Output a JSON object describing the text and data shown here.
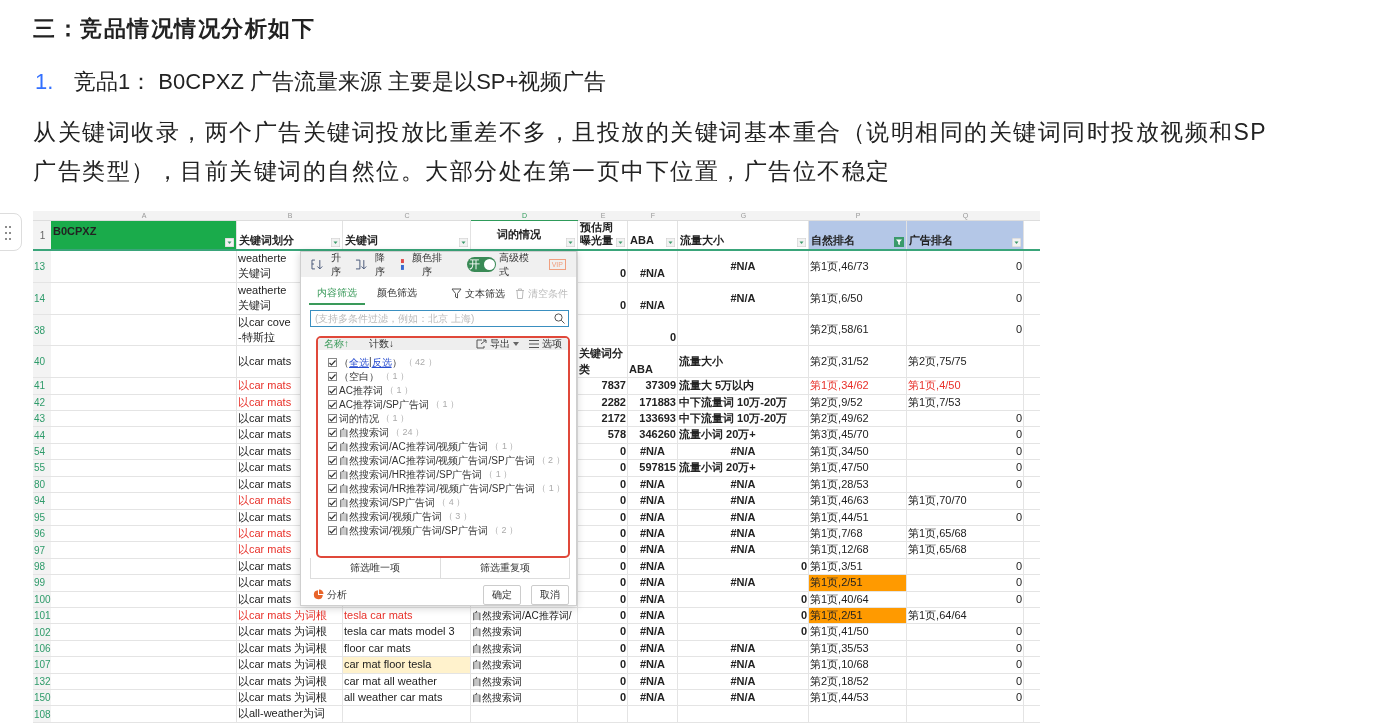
{
  "article": {
    "heading": "三：竞品情况情况分析如下",
    "list": [
      {
        "marker": "1.",
        "text": "竞品1： B0CPXZ 广告流量来源 主要是以SP+视频广告"
      }
    ],
    "paragraph": "从关键词收录，两个广告关键词投放比重差不多，且投放的关键词基本重合（说明相同的关键词同时投放视频和SP广告类型），目前关键词的自然位。大部分处在第一页中下位置，广告位不稳定"
  },
  "sheet": {
    "header_row_number": "1",
    "columns": [
      {
        "letter": "A",
        "header": "B0CPXZ",
        "color": "#1aab4b",
        "filter_active": false
      },
      {
        "letter": "B",
        "header": "关键词划分",
        "color": "#ffffff",
        "filter_active": false
      },
      {
        "letter": "C",
        "header": "关键词",
        "color": "#ffffff",
        "filter_active": false
      },
      {
        "letter": "D",
        "header": "词的情况",
        "color": "#ffffff",
        "filter_active": false
      },
      {
        "letter": "E",
        "header": "预估周曝光量",
        "color": "#ffffff",
        "filter_active": false
      },
      {
        "letter": "F",
        "header": "ABA",
        "color": "#ffffff",
        "filter_active": false
      },
      {
        "letter": "G",
        "header": "流量大小",
        "color": "#ffffff",
        "filter_active": false
      },
      {
        "letter": "P",
        "header": "自然排名",
        "color": "#b4c7e7",
        "filter_active": true
      },
      {
        "letter": "Q",
        "header": "广告排名",
        "color": "#b4c7e7",
        "filter_active": false
      }
    ],
    "rows": [
      {
        "number": "13",
        "cells": {
          "B": {
            "text": "weatherte\n关键词",
            "kind": "text"
          },
          "E": {
            "text": "0",
            "kind": "number"
          },
          "F": {
            "text": "#N/A",
            "kind": "error"
          },
          "G": {
            "text": "#N/A",
            "kind": "error"
          },
          "P": {
            "text": "第1页,46/73",
            "kind": "text"
          },
          "Q": {
            "text": "0",
            "kind": "number"
          }
        }
      },
      {
        "number": "14",
        "cells": {
          "B": {
            "text": "weatherte\n关键词",
            "kind": "text"
          },
          "E": {
            "text": "0",
            "kind": "number"
          },
          "F": {
            "text": "#N/A",
            "kind": "error"
          },
          "G": {
            "text": "#N/A",
            "kind": "error"
          },
          "P": {
            "text": "第1页,6/50",
            "kind": "text"
          },
          "Q": {
            "text": "0",
            "kind": "number"
          }
        }
      },
      {
        "number": "38",
        "cells": {
          "B": {
            "text": "以car cove\n-特斯拉",
            "kind": "text"
          },
          "F": {
            "text": "0",
            "kind": "number"
          },
          "P": {
            "text": "第2页,58/61",
            "kind": "text"
          },
          "Q": {
            "text": "0",
            "kind": "number"
          }
        }
      },
      {
        "number": "40",
        "cells": {
          "B": {
            "text": "以car mats",
            "kind": "text"
          },
          "E": {
            "text": "关键词分类",
            "kind": "text"
          },
          "F": {
            "text": "ABA",
            "kind": "text"
          },
          "G": {
            "text": "流量大小",
            "kind": "text"
          },
          "P": {
            "text": "第2页,31/52",
            "kind": "text"
          },
          "Q": {
            "text": "第2页,75/75",
            "kind": "text"
          }
        }
      },
      {
        "number": "41",
        "cells": {
          "B": {
            "text": "以car mats",
            "kind": "text",
            "color": "#e8312a"
          },
          "E": {
            "text": "7837",
            "kind": "number"
          },
          "F": {
            "text": "37309",
            "kind": "number"
          },
          "G": {
            "text": "流量大 5万以内",
            "kind": "text"
          },
          "P": {
            "text": "第1页,34/62",
            "kind": "text",
            "color": "#e8312a"
          },
          "Q": {
            "text": "第1页,4/50",
            "kind": "text",
            "color": "#e8312a"
          }
        }
      },
      {
        "number": "42",
        "cells": {
          "B": {
            "text": "以car mats",
            "kind": "text",
            "color": "#e8312a"
          },
          "E": {
            "text": "2282",
            "kind": "number"
          },
          "F": {
            "text": "171883",
            "kind": "number"
          },
          "G": {
            "text": "中下流量词 10万-20万",
            "kind": "text"
          },
          "P": {
            "text": "第2页,9/52",
            "kind": "text"
          },
          "Q": {
            "text": "第1页,7/53",
            "kind": "text"
          }
        }
      },
      {
        "number": "43",
        "cells": {
          "B": {
            "text": "以car mats",
            "kind": "text"
          },
          "E": {
            "text": "2172",
            "kind": "number"
          },
          "F": {
            "text": "133693",
            "kind": "number"
          },
          "G": {
            "text": "中下流量词 10万-20万",
            "kind": "text"
          },
          "P": {
            "text": "第2页,49/62",
            "kind": "text"
          },
          "Q": {
            "text": "0",
            "kind": "number"
          }
        }
      },
      {
        "number": "44",
        "cells": {
          "B": {
            "text": "以car mats",
            "kind": "text"
          },
          "E": {
            "text": "578",
            "kind": "number"
          },
          "F": {
            "text": "346260",
            "kind": "number"
          },
          "G": {
            "text": "流量小词 20万+",
            "kind": "text"
          },
          "P": {
            "text": "第3页,45/70",
            "kind": "text"
          },
          "Q": {
            "text": "0",
            "kind": "number"
          }
        }
      },
      {
        "number": "54",
        "cells": {
          "B": {
            "text": "以car mats",
            "kind": "text"
          },
          "E": {
            "text": "0",
            "kind": "number"
          },
          "F": {
            "text": "#N/A",
            "kind": "error"
          },
          "G": {
            "text": "#N/A",
            "kind": "error"
          },
          "P": {
            "text": "第1页,34/50",
            "kind": "text"
          },
          "Q": {
            "text": "0",
            "kind": "number"
          }
        }
      },
      {
        "number": "55",
        "cells": {
          "B": {
            "text": "以car mats",
            "kind": "text"
          },
          "E": {
            "text": "0",
            "kind": "number"
          },
          "F": {
            "text": "597815",
            "kind": "number"
          },
          "G": {
            "text": "流量小词 20万+",
            "kind": "text"
          },
          "P": {
            "text": "第1页,47/50",
            "kind": "text"
          },
          "Q": {
            "text": "0",
            "kind": "number"
          }
        }
      },
      {
        "number": "80",
        "cells": {
          "B": {
            "text": "以car mats",
            "kind": "text"
          },
          "E": {
            "text": "0",
            "kind": "number"
          },
          "F": {
            "text": "#N/A",
            "kind": "error"
          },
          "G": {
            "text": "#N/A",
            "kind": "error"
          },
          "P": {
            "text": "第1页,28/53",
            "kind": "text"
          },
          "Q": {
            "text": "0",
            "kind": "number"
          }
        }
      },
      {
        "number": "94",
        "cells": {
          "B": {
            "text": "以car mats",
            "kind": "text",
            "color": "#e8312a"
          },
          "E": {
            "text": "0",
            "kind": "number"
          },
          "F": {
            "text": "#N/A",
            "kind": "error"
          },
          "G": {
            "text": "#N/A",
            "kind": "error"
          },
          "P": {
            "text": "第1页,46/63",
            "kind": "text"
          },
          "Q": {
            "text": "第1页,70/70",
            "kind": "text"
          }
        }
      },
      {
        "number": "95",
        "cells": {
          "B": {
            "text": "以car mats",
            "kind": "text"
          },
          "E": {
            "text": "0",
            "kind": "number"
          },
          "F": {
            "text": "#N/A",
            "kind": "error"
          },
          "G": {
            "text": "#N/A",
            "kind": "error"
          },
          "P": {
            "text": "第1页,44/51",
            "kind": "text"
          },
          "Q": {
            "text": "0",
            "kind": "number"
          }
        }
      },
      {
        "number": "96",
        "cells": {
          "B": {
            "text": "以car mats",
            "kind": "text",
            "color": "#e8312a"
          },
          "E": {
            "text": "0",
            "kind": "number"
          },
          "F": {
            "text": "#N/A",
            "kind": "error"
          },
          "G": {
            "text": "#N/A",
            "kind": "error"
          },
          "P": {
            "text": "第1页,7/68",
            "kind": "text"
          },
          "Q": {
            "text": "第1页,65/68",
            "kind": "text"
          }
        }
      },
      {
        "number": "97",
        "cells": {
          "B": {
            "text": "以car mats",
            "kind": "text",
            "color": "#e8312a"
          },
          "E": {
            "text": "0",
            "kind": "number"
          },
          "F": {
            "text": "#N/A",
            "kind": "error"
          },
          "G": {
            "text": "#N/A",
            "kind": "error"
          },
          "P": {
            "text": "第1页,12/68",
            "kind": "text"
          },
          "Q": {
            "text": "第1页,65/68",
            "kind": "text"
          }
        }
      },
      {
        "number": "98",
        "cells": {
          "B": {
            "text": "以car mats",
            "kind": "text"
          },
          "E": {
            "text": "0",
            "kind": "number"
          },
          "F": {
            "text": "#N/A",
            "kind": "error"
          },
          "G": {
            "text": "0",
            "kind": "number"
          },
          "P": {
            "text": "第1页,3/51",
            "kind": "text"
          },
          "Q": {
            "text": "0",
            "kind": "number"
          }
        }
      },
      {
        "number": "99",
        "cells": {
          "B": {
            "text": "以car mats",
            "kind": "text"
          },
          "E": {
            "text": "0",
            "kind": "number"
          },
          "F": {
            "text": "#N/A",
            "kind": "error"
          },
          "G": {
            "text": "#N/A",
            "kind": "error"
          },
          "P": {
            "text": "第1页,2/51",
            "kind": "text",
            "background": {
              "color": "#ff9a00"
            }
          },
          "Q": {
            "text": "0",
            "kind": "number"
          }
        }
      },
      {
        "number": "100",
        "cells": {
          "B": {
            "text": "以car mats",
            "kind": "text"
          },
          "E": {
            "text": "0",
            "kind": "number"
          },
          "F": {
            "text": "#N/A",
            "kind": "error"
          },
          "G": {
            "text": "0",
            "kind": "number"
          },
          "P": {
            "text": "第1页,40/64",
            "kind": "text"
          },
          "Q": {
            "text": "0",
            "kind": "number"
          }
        }
      },
      {
        "number": "101",
        "cells": {
          "B": {
            "text": "以car mats 为词根",
            "kind": "text",
            "color": "#e8312a"
          },
          "C": {
            "text": "tesla car mats",
            "kind": "text",
            "color": "#e8312a"
          },
          "D": {
            "text": "自然搜索词/AC推荐词/",
            "kind": "text"
          },
          "E": {
            "text": "0",
            "kind": "number"
          },
          "F": {
            "text": "#N/A",
            "kind": "error"
          },
          "G": {
            "text": "0",
            "kind": "number"
          },
          "P": {
            "text": "第1页,2/51",
            "kind": "text",
            "background": {
              "color": "#ff9a00"
            }
          },
          "Q": {
            "text": "第1页,64/64",
            "kind": "text"
          }
        }
      },
      {
        "number": "102",
        "cells": {
          "B": {
            "text": "以car mats 为词根",
            "kind": "text"
          },
          "C": {
            "text": "tesla car mats model 3",
            "kind": "text"
          },
          "D": {
            "text": "自然搜索词",
            "kind": "text"
          },
          "E": {
            "text": "0",
            "kind": "number"
          },
          "F": {
            "text": "#N/A",
            "kind": "error"
          },
          "G": {
            "text": "0",
            "kind": "number"
          },
          "P": {
            "text": "第1页,41/50",
            "kind": "text"
          },
          "Q": {
            "text": "0",
            "kind": "number"
          }
        }
      },
      {
        "number": "106",
        "cells": {
          "B": {
            "text": "以car mats 为词根",
            "kind": "text"
          },
          "C": {
            "text": "floor car mats",
            "kind": "text"
          },
          "D": {
            "text": "自然搜索词",
            "kind": "text"
          },
          "E": {
            "text": "0",
            "kind": "number"
          },
          "F": {
            "text": "#N/A",
            "kind": "error"
          },
          "G": {
            "text": "#N/A",
            "kind": "error"
          },
          "P": {
            "text": "第1页,35/53",
            "kind": "text"
          },
          "Q": {
            "text": "0",
            "kind": "number"
          }
        }
      },
      {
        "number": "107",
        "cells": {
          "B": {
            "text": "以car mats 为词根",
            "kind": "text"
          },
          "C": {
            "text": "car mat floor tesla",
            "kind": "text",
            "background": {
              "color": "#fff2cc"
            }
          },
          "D": {
            "text": "自然搜索词",
            "kind": "text"
          },
          "E": {
            "text": "0",
            "kind": "number"
          },
          "F": {
            "text": "#N/A",
            "kind": "error"
          },
          "G": {
            "text": "#N/A",
            "kind": "error"
          },
          "P": {
            "text": "第1页,10/68",
            "kind": "text"
          },
          "Q": {
            "text": "0",
            "kind": "number"
          }
        }
      },
      {
        "number": "132",
        "cells": {
          "B": {
            "text": "以car mats 为词根",
            "kind": "text"
          },
          "C": {
            "text": "car mat all weather",
            "kind": "text"
          },
          "D": {
            "text": "自然搜索词",
            "kind": "text"
          },
          "E": {
            "text": "0",
            "kind": "number"
          },
          "F": {
            "text": "#N/A",
            "kind": "error"
          },
          "G": {
            "text": "#N/A",
            "kind": "error"
          },
          "P": {
            "text": "第2页,18/52",
            "kind": "text"
          },
          "Q": {
            "text": "0",
            "kind": "number"
          }
        }
      },
      {
        "number": "150",
        "cells": {
          "B": {
            "text": "以car mats 为词根",
            "kind": "text"
          },
          "C": {
            "text": "all weather car mats",
            "kind": "text"
          },
          "D": {
            "text": "自然搜索词",
            "kind": "text"
          },
          "E": {
            "text": "0",
            "kind": "number"
          },
          "F": {
            "text": "#N/A",
            "kind": "error"
          },
          "G": {
            "text": "#N/A",
            "kind": "error"
          },
          "P": {
            "text": "第1页,44/53",
            "kind": "text"
          },
          "Q": {
            "text": "0",
            "kind": "number"
          }
        }
      },
      {
        "number": "108",
        "cells": {
          "B": {
            "text": "以all-weather为词",
            "kind": "text"
          }
        }
      }
    ]
  },
  "filter_popup": {
    "sort_buttons": [
      "升序",
      "降序",
      "颜色排序"
    ],
    "advanced": {
      "switch_text": "开",
      "on": true,
      "label": "高级模式",
      "badge": "VIP"
    },
    "tabs": [
      {
        "label": "内容筛选",
        "selected": true
      },
      {
        "label": "颜色筛选",
        "selected": false
      }
    ],
    "text_filter": "文本筛选",
    "clear": {
      "label": "清空条件",
      "disabled": true
    },
    "search": {
      "placeholder": "(支持多条件过滤，例如：北京 上海)"
    },
    "list_header": {
      "name_sort": "名称↑",
      "count_sort": "计数↓",
      "export": "导出",
      "options": "选项"
    },
    "items": [
      {
        "kind": "select_all",
        "parts": [
          {
            "text": "（",
            "link": false
          },
          {
            "text": "全选",
            "link": true
          },
          {
            "text": "|",
            "link": false
          },
          {
            "text": "反选",
            "link": true
          },
          {
            "text": "）",
            "link": false
          }
        ],
        "count": "（ 42 ）",
        "checked": true
      },
      {
        "kind": "value",
        "label": "（空白）",
        "count": "（ 1 ）",
        "checked": true
      },
      {
        "kind": "value",
        "label": "AC推荐词",
        "count": "（ 1 ）",
        "checked": true
      },
      {
        "kind": "value",
        "label": "AC推荐词/SP广告词",
        "count": "（ 1 ）",
        "checked": true
      },
      {
        "kind": "value",
        "label": "词的情况",
        "count": "（ 1 ）",
        "checked": true
      },
      {
        "kind": "value",
        "label": "自然搜索词",
        "count": "（ 24 ）",
        "checked": true
      },
      {
        "kind": "value",
        "label": "自然搜索词/AC推荐词/视频广告词",
        "count": "（ 1 ）",
        "checked": true
      },
      {
        "kind": "value",
        "label": "自然搜索词/AC推荐词/视频广告词/SP广告词",
        "count": "（ 2 ）",
        "checked": true
      },
      {
        "kind": "value",
        "label": "自然搜索词/HR推荐词/SP广告词",
        "count": "（ 1 ）",
        "checked": true
      },
      {
        "kind": "value",
        "label": "自然搜索词/HR推荐词/视频广告词/SP广告词",
        "count": "（ 1 ）",
        "checked": true
      },
      {
        "kind": "value",
        "label": "自然搜索词/SP广告词",
        "count": "（ 4 ）",
        "checked": true
      },
      {
        "kind": "value",
        "label": "自然搜索词/视频广告词",
        "count": "（ 3 ）",
        "checked": true
      },
      {
        "kind": "value",
        "label": "自然搜索词/视频广告词/SP广告词",
        "count": "（ 2 ）",
        "checked": true
      }
    ],
    "filter_buttons": [
      "筛选唯一项",
      "筛选重复项"
    ],
    "analyze": "分析",
    "actions": [
      "确定",
      "取消"
    ]
  }
}
